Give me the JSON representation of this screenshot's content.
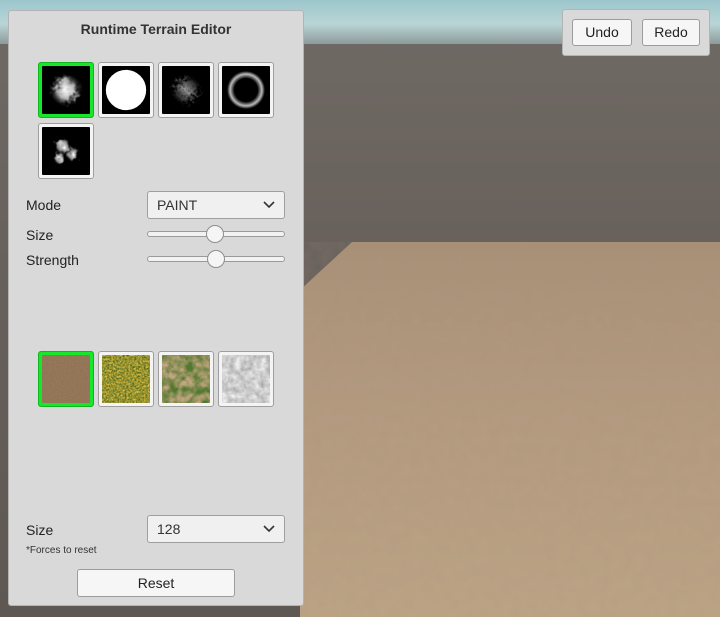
{
  "panel": {
    "title": "Runtime Terrain Editor",
    "brushes": [
      {
        "name": "cloud-soft-brush",
        "selected": true
      },
      {
        "name": "hard-circle-brush",
        "selected": false
      },
      {
        "name": "noise-brush",
        "selected": false
      },
      {
        "name": "ring-brush",
        "selected": false
      },
      {
        "name": "splat-brush",
        "selected": false
      }
    ],
    "mode": {
      "label": "Mode",
      "value": "PAINT"
    },
    "size": {
      "label": "Size",
      "value_fraction": 0.49
    },
    "strength": {
      "label": "Strength",
      "value_fraction": 0.5
    },
    "textures": [
      {
        "name": "dirt-texture",
        "selected": true
      },
      {
        "name": "grass-flowers-texture",
        "selected": false
      },
      {
        "name": "grass-texture",
        "selected": false
      },
      {
        "name": "rock-texture",
        "selected": false
      }
    ],
    "resolution": {
      "label": "Size",
      "value": "128",
      "note": "*Forces to reset"
    },
    "reset_label": "Reset"
  },
  "toolbar": {
    "undo_label": "Undo",
    "redo_label": "Redo"
  },
  "colors": {
    "selected_border": "#17e62a",
    "terrain": "#b9a084",
    "panel_bg": "#d9d9d9"
  }
}
